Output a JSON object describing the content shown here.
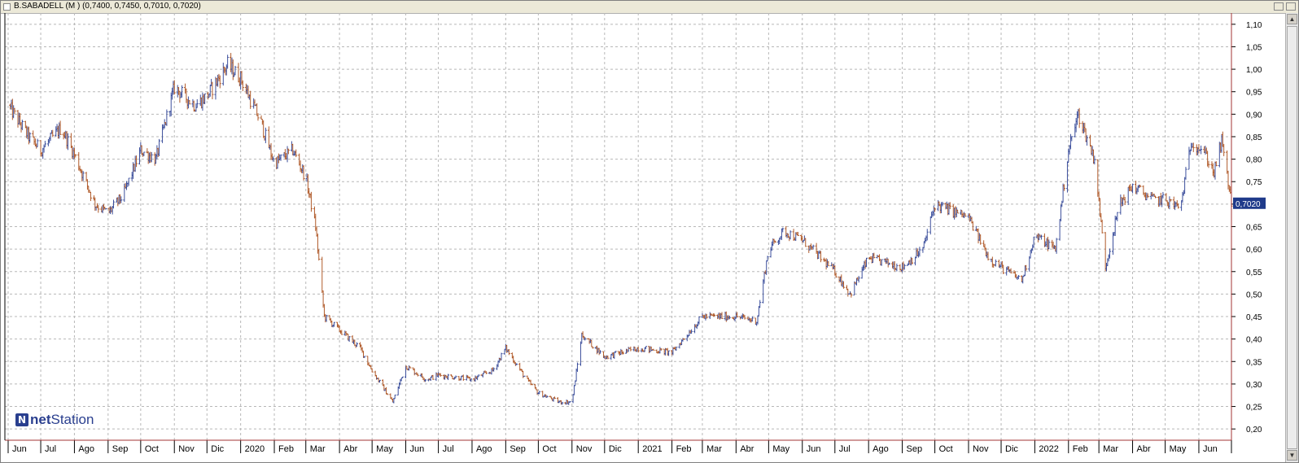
{
  "window": {
    "title": "B.SABADELL (M ) (0,7400, 0,7450, 0,7010, 0,7020)"
  },
  "watermark": {
    "logo_text": "netStation",
    "logo_net": "net",
    "logo_station": "Station"
  },
  "chart_data": {
    "type": "ohlc",
    "title": "B.SABADELL (M ) (0,7400, 0,7450, 0,7010, 0,7020)",
    "ylim": [
      0.175,
      1.125
    ],
    "y_ticks": [
      "0,20",
      "0,25",
      "0,30",
      "0,35",
      "0,40",
      "0,45",
      "0,50",
      "0,55",
      "0,60",
      "0,65",
      "0,70",
      "0,75",
      "0,80",
      "0,85",
      "0,90",
      "0,95",
      "1,00",
      "1,05",
      "1,10"
    ],
    "last_price_label": "0,7020",
    "last_price": 0.702,
    "grid": true,
    "x_labels": [
      "Jun",
      "Jul",
      "Ago",
      "Sep",
      "Oct",
      "Nov",
      "Dic",
      "2020",
      "Feb",
      "Mar",
      "Abr",
      "May",
      "Jun",
      "Jul",
      "Ago",
      "Sep",
      "Oct",
      "Nov",
      "Dic",
      "2021",
      "Feb",
      "Mar",
      "Abr",
      "May",
      "Jun",
      "Jul",
      "Ago",
      "Sep",
      "Oct",
      "Nov",
      "Dic",
      "2022",
      "Feb",
      "Mar",
      "Abr",
      "May",
      "Jun"
    ],
    "price_path": [
      {
        "x": "2019-06-01",
        "y": 0.92
      },
      {
        "x": "2019-06-20",
        "y": 0.85
      },
      {
        "x": "2019-07-01",
        "y": 0.82
      },
      {
        "x": "2019-07-20",
        "y": 0.87
      },
      {
        "x": "2019-08-01",
        "y": 0.81
      },
      {
        "x": "2019-08-20",
        "y": 0.7
      },
      {
        "x": "2019-09-01",
        "y": 0.68
      },
      {
        "x": "2019-09-15",
        "y": 0.72
      },
      {
        "x": "2019-10-01",
        "y": 0.82
      },
      {
        "x": "2019-10-15",
        "y": 0.8
      },
      {
        "x": "2019-11-01",
        "y": 0.96
      },
      {
        "x": "2019-11-20",
        "y": 0.92
      },
      {
        "x": "2019-12-01",
        "y": 0.94
      },
      {
        "x": "2019-12-20",
        "y": 1.01
      },
      {
        "x": "2020-01-01",
        "y": 0.98
      },
      {
        "x": "2020-01-20",
        "y": 0.88
      },
      {
        "x": "2020-02-01",
        "y": 0.79
      },
      {
        "x": "2020-02-18",
        "y": 0.82
      },
      {
        "x": "2020-03-01",
        "y": 0.76
      },
      {
        "x": "2020-03-10",
        "y": 0.65
      },
      {
        "x": "2020-03-18",
        "y": 0.45
      },
      {
        "x": "2020-04-01",
        "y": 0.42
      },
      {
        "x": "2020-04-20",
        "y": 0.38
      },
      {
        "x": "2020-05-01",
        "y": 0.33
      },
      {
        "x": "2020-05-20",
        "y": 0.26
      },
      {
        "x": "2020-06-01",
        "y": 0.34
      },
      {
        "x": "2020-06-20",
        "y": 0.31
      },
      {
        "x": "2020-07-01",
        "y": 0.32
      },
      {
        "x": "2020-08-01",
        "y": 0.31
      },
      {
        "x": "2020-08-20",
        "y": 0.33
      },
      {
        "x": "2020-09-01",
        "y": 0.38
      },
      {
        "x": "2020-09-20",
        "y": 0.31
      },
      {
        "x": "2020-10-01",
        "y": 0.28
      },
      {
        "x": "2020-10-20",
        "y": 0.26
      },
      {
        "x": "2020-11-01",
        "y": 0.26
      },
      {
        "x": "2020-11-10",
        "y": 0.41
      },
      {
        "x": "2020-12-01",
        "y": 0.36
      },
      {
        "x": "2021-01-01",
        "y": 0.38
      },
      {
        "x": "2021-02-01",
        "y": 0.37
      },
      {
        "x": "2021-03-01",
        "y": 0.45
      },
      {
        "x": "2021-04-01",
        "y": 0.45
      },
      {
        "x": "2021-04-20",
        "y": 0.44
      },
      {
        "x": "2021-05-01",
        "y": 0.6
      },
      {
        "x": "2021-05-15",
        "y": 0.64
      },
      {
        "x": "2021-06-01",
        "y": 0.62
      },
      {
        "x": "2021-07-01",
        "y": 0.55
      },
      {
        "x": "2021-07-15",
        "y": 0.5
      },
      {
        "x": "2021-08-01",
        "y": 0.58
      },
      {
        "x": "2021-09-01",
        "y": 0.56
      },
      {
        "x": "2021-09-20",
        "y": 0.6
      },
      {
        "x": "2021-10-01",
        "y": 0.7
      },
      {
        "x": "2021-11-01",
        "y": 0.67
      },
      {
        "x": "2021-11-20",
        "y": 0.58
      },
      {
        "x": "2021-12-01",
        "y": 0.56
      },
      {
        "x": "2021-12-20",
        "y": 0.53
      },
      {
        "x": "2022-01-01",
        "y": 0.63
      },
      {
        "x": "2022-01-20",
        "y": 0.6
      },
      {
        "x": "2022-02-01",
        "y": 0.82
      },
      {
        "x": "2022-02-10",
        "y": 0.9
      },
      {
        "x": "2022-02-25",
        "y": 0.8
      },
      {
        "x": "2022-03-07",
        "y": 0.56
      },
      {
        "x": "2022-03-20",
        "y": 0.7
      },
      {
        "x": "2022-04-01",
        "y": 0.74
      },
      {
        "x": "2022-04-20",
        "y": 0.71
      },
      {
        "x": "2022-05-01",
        "y": 0.71
      },
      {
        "x": "2022-05-15",
        "y": 0.69
      },
      {
        "x": "2022-05-25",
        "y": 0.84
      },
      {
        "x": "2022-06-05",
        "y": 0.82
      },
      {
        "x": "2022-06-15",
        "y": 0.77
      },
      {
        "x": "2022-06-22",
        "y": 0.84
      },
      {
        "x": "2022-07-01",
        "y": 0.702
      }
    ],
    "colors": {
      "up_bar": "#3c4f9c",
      "down_bar": "#b05a2a",
      "grid": "#b8b8b8",
      "axis_border": "#a33636",
      "last_price_bg": "#1f3a8a",
      "last_price_fg": "#ffffff",
      "label": "#000000"
    }
  }
}
